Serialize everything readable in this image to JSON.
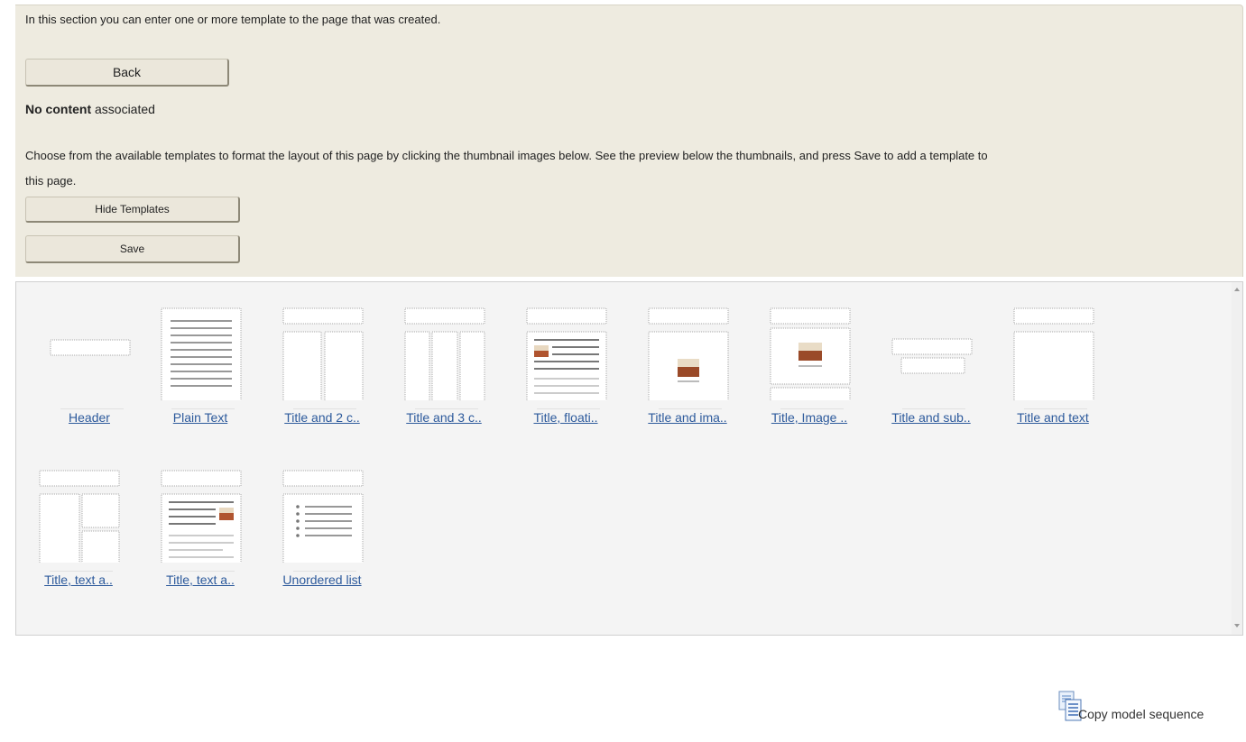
{
  "intro": {
    "text": "In this section you can enter one or more template to the page that was created.",
    "back_label": "Back"
  },
  "content_status": {
    "bold": "No content",
    "rest": " associated"
  },
  "instructions": {
    "line1": "Choose from the available templates to format the layout of this page by clicking the thumbnail images below. See the preview below the thumbnails, and press Save to add a template to",
    "line2": "this page."
  },
  "buttons": {
    "hide_templates": "Hide Templates",
    "save": "Save"
  },
  "templates": [
    {
      "label": "Header",
      "icon": "header-layout-icon"
    },
    {
      "label": "Plain Text",
      "icon": "plain-text-layout-icon"
    },
    {
      "label": "Title and 2 c..",
      "icon": "two-columns-layout-icon"
    },
    {
      "label": "Title and 3 c..",
      "icon": "three-columns-layout-icon"
    },
    {
      "label": "Title, floati..",
      "icon": "floating-image-layout-icon"
    },
    {
      "label": "Title and ima..",
      "icon": "title-image-layout-icon"
    },
    {
      "label": "Title, Image ..",
      "icon": "title-image-caption-layout-icon"
    },
    {
      "label": "Title and sub..",
      "icon": "title-subtitle-layout-icon"
    },
    {
      "label": "Title and text",
      "icon": "title-text-layout-icon"
    },
    {
      "label": "Title, text a..",
      "icon": "title-text-boxes-layout-icon"
    },
    {
      "label": "Title, text a..",
      "icon": "title-text-image-layout-icon"
    },
    {
      "label": "Unordered list",
      "icon": "unordered-list-layout-icon"
    }
  ],
  "copy_model": {
    "label": "Copy model sequence",
    "icon": "copy-document-icon"
  },
  "colors": {
    "panel_bg": "#eeebe0",
    "link": "#2d5a9c",
    "gallery_bg": "#f4f4f4"
  }
}
